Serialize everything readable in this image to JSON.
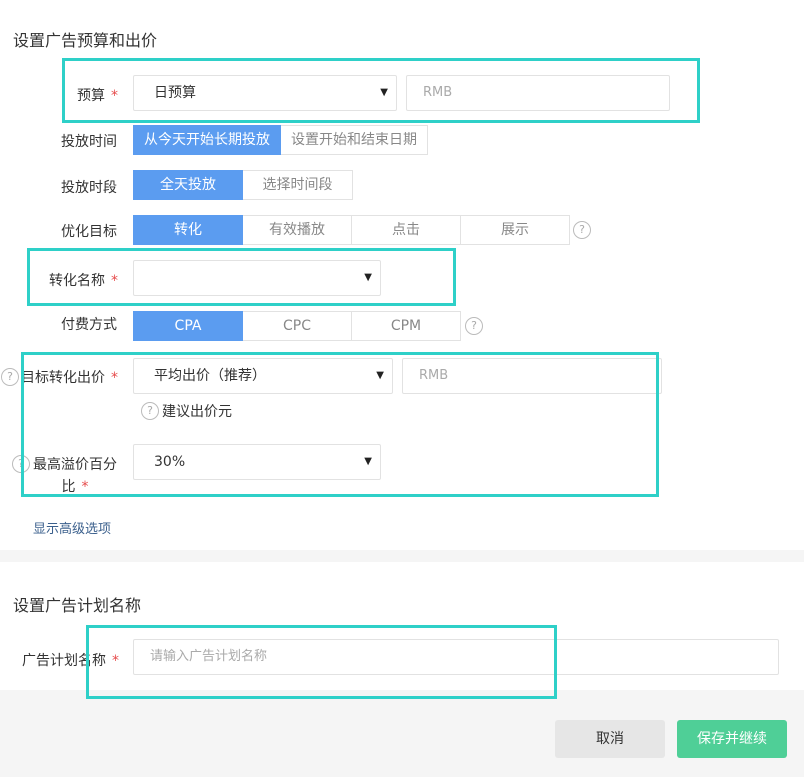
{
  "budget_section": {
    "title": "设置广告预算和出价",
    "budget": {
      "label": "预算",
      "required": "*",
      "type": "日预算",
      "amount_placeholder": "RMB"
    },
    "schedule": {
      "label": "投放时间",
      "options": [
        "从今天开始长期投放",
        "设置开始和结束日期"
      ],
      "selected": 0
    },
    "time_period": {
      "label": "投放时段",
      "options": [
        "全天投放",
        "选择时间段"
      ],
      "selected": 0
    },
    "goal": {
      "label": "优化目标",
      "options": [
        "转化",
        "有效播放",
        "点击",
        "展示"
      ],
      "selected": 0,
      "help": "?"
    },
    "conversion_name": {
      "label": "转化名称",
      "required": "*",
      "value": ""
    },
    "billing": {
      "label": "付费方式",
      "options": [
        "CPA",
        "CPC",
        "CPM"
      ],
      "selected": 0,
      "help": "?"
    },
    "target_bid": {
      "label": "目标转化出价",
      "required": "*",
      "help": "?",
      "mode": "平均出价（推荐）",
      "amount_placeholder": "RMB",
      "suggestion": "建议出价元"
    },
    "premium": {
      "label_line1": "最高溢价百分",
      "label_line2": "比",
      "required": "*",
      "help": "?",
      "value": "30%"
    },
    "advanced_link": "显示高级选项"
  },
  "name_section": {
    "title": "设置广告计划名称",
    "plan_name": {
      "label": "广告计划名称",
      "required": "*",
      "placeholder": "请输入广告计划名称"
    }
  },
  "footer": {
    "cancel": "取消",
    "save": "保存并继续"
  },
  "colors": {
    "accent": "#5b9cf0",
    "highlight": "#2ed0c8",
    "save": "#4fcf97",
    "required": "#e64b4b"
  },
  "icons": {
    "caret": "caret-down-icon",
    "help": "question-circle-icon"
  }
}
